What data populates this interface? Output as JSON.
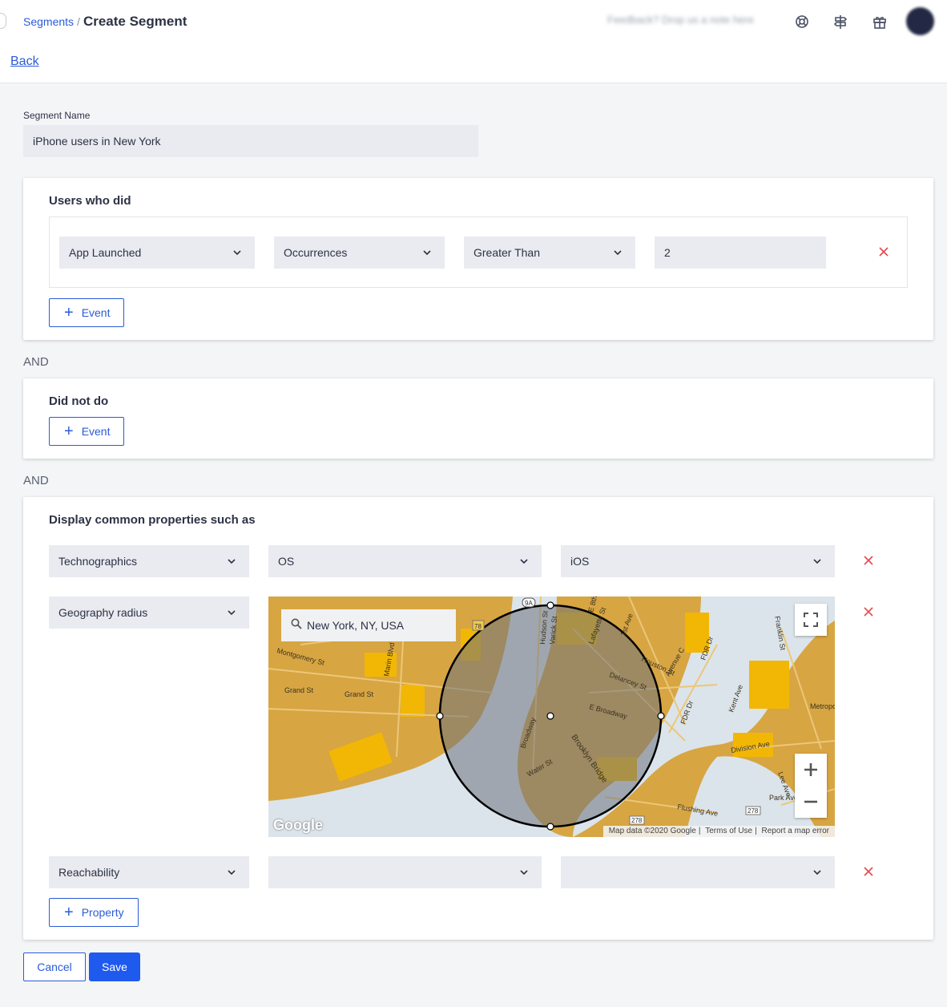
{
  "header": {
    "breadcrumb_parent": "Segments",
    "breadcrumb_sep": "/",
    "breadcrumb_current": "Create Segment",
    "feedback": "Feedback? Drop us a note here",
    "back": "Back"
  },
  "segment_name": {
    "label": "Segment Name",
    "value": "iPhone users in New York"
  },
  "users_who_did": {
    "title": "Users who did",
    "event": "App Launched",
    "metric": "Occurrences",
    "operator": "Greater Than",
    "value": "2",
    "add_label": "Event"
  },
  "and_label": "AND",
  "did_not_do": {
    "title": "Did not do",
    "add_label": "Event"
  },
  "properties": {
    "title": "Display common properties such as",
    "rows": [
      {
        "category": "Technographics",
        "field": "OS",
        "value": "iOS"
      },
      {
        "category": "Geography radius"
      },
      {
        "category": "Reachability",
        "field": "",
        "value": ""
      }
    ],
    "add_label": "Property"
  },
  "map": {
    "search": "New York, NY, USA",
    "footer": [
      "Map data ©2020 Google",
      "Terms of Use",
      "Report a map error"
    ],
    "brand": "Google",
    "street_labels": [
      "Montgomery St",
      "Grand St",
      "Grand St",
      "Marin Blvd",
      "Hudson St",
      "Varick St",
      "Lafayette St",
      "Delancey St",
      "E Broadway",
      "Broadway",
      "Water St",
      "Brooklyn Bridge",
      "FDR Dr",
      "FDR Dr",
      "Avenue C",
      "Houston St",
      "Kent Ave",
      "Division Ave",
      "Flushing Ave",
      "Franklin St",
      "Metropol",
      "Lee Ave",
      "Park Ave",
      "E 8th St",
      "1st Ave",
      "9A",
      "78",
      "278",
      "278"
    ]
  },
  "actions": {
    "cancel": "Cancel",
    "save": "Save"
  },
  "colors": {
    "accent": "#2b5bd7",
    "primary": "#1f5aef",
    "remove": "#e5484d",
    "field_bg": "#e9ebf0"
  }
}
